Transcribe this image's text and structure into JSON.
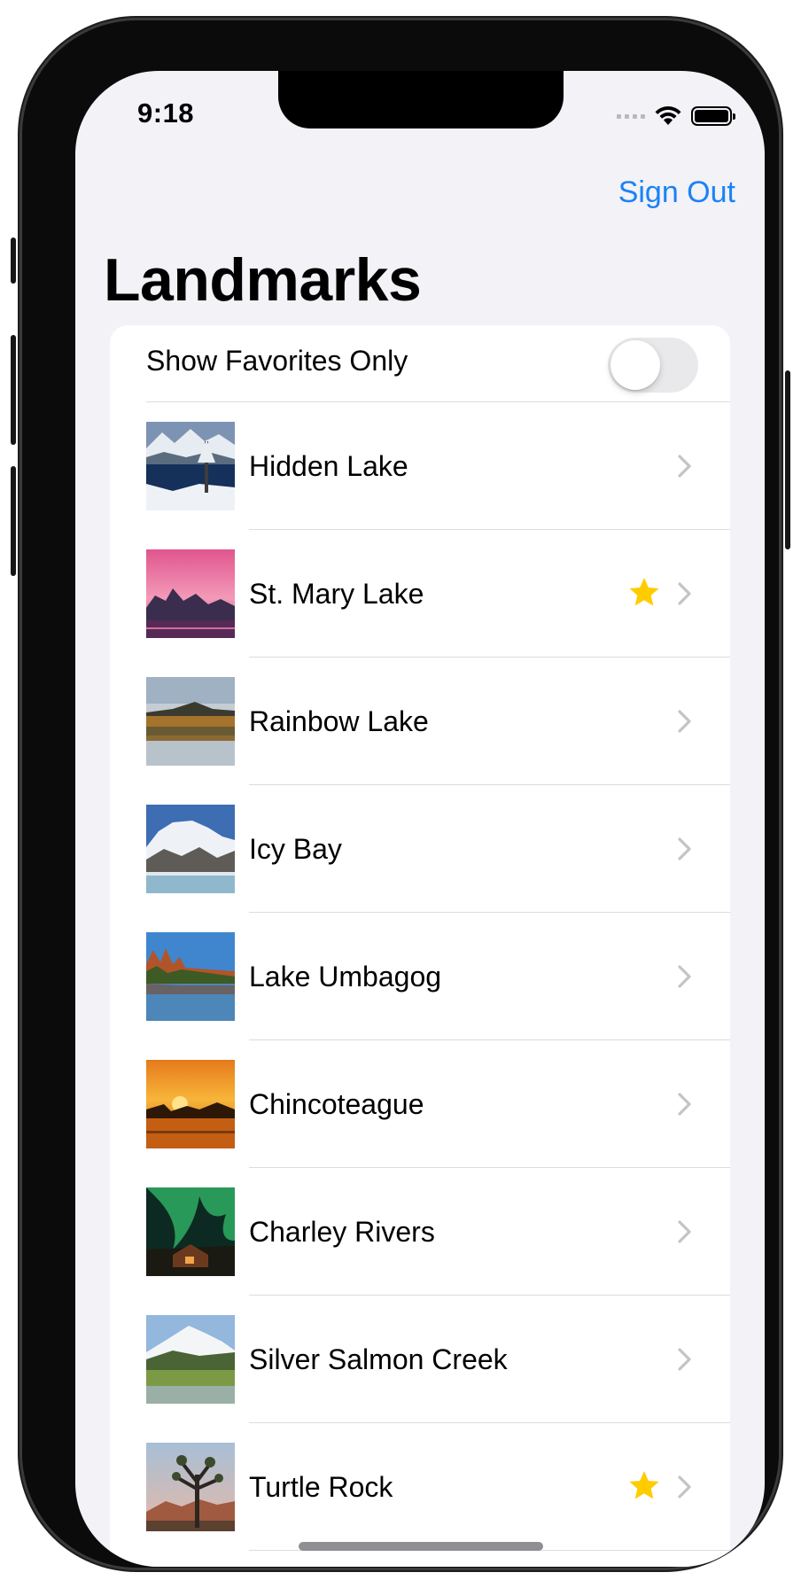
{
  "status_bar": {
    "time": "9:18"
  },
  "nav": {
    "sign_out_label": "Sign Out",
    "title": "Landmarks"
  },
  "toggle": {
    "label": "Show Favorites Only",
    "value": false
  },
  "colors": {
    "accent": "#1a82f7",
    "star": "#ffcc00",
    "chevron": "#c4c4c7",
    "background": "#f2f2f7"
  },
  "landmarks": [
    {
      "name": "Hidden Lake",
      "favorite": false
    },
    {
      "name": "St. Mary Lake",
      "favorite": true
    },
    {
      "name": "Rainbow Lake",
      "favorite": false
    },
    {
      "name": "Icy Bay",
      "favorite": false
    },
    {
      "name": "Lake Umbagog",
      "favorite": false
    },
    {
      "name": "Chincoteague",
      "favorite": false
    },
    {
      "name": "Charley Rivers",
      "favorite": false
    },
    {
      "name": "Silver Salmon Creek",
      "favorite": false
    },
    {
      "name": "Turtle Rock",
      "favorite": true
    }
  ]
}
